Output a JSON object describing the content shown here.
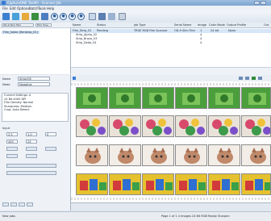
{
  "window": {
    "title": "CaptureONE ToolKit - Scanner Job"
  },
  "menu": [
    "File",
    "Edit",
    "Options",
    "Batch",
    "Tools",
    "Help"
  ],
  "toolbar_icons": [
    "scan-icon",
    "grid-icon",
    "folder-icon",
    "image-icon",
    "refresh-icon",
    "preview-circle-icon",
    "zoom-circle-icon",
    "rotate-circle-icon",
    "settings-circle-icon",
    "crop-icon",
    "frame-icon",
    "split-icon",
    "pages-icon"
  ],
  "sidebar": {
    "scanner_select": "OD-9 Slim Film",
    "job_button": "Film Type",
    "tree_root": "Film_Index (filmstrip_01)"
  },
  "grid": {
    "columns": [
      "Name",
      "Status",
      "Job Type",
      "Serial Name",
      "Image",
      "Color Mode",
      "Output Profile",
      "Out"
    ],
    "rows": [
      {
        "name": "Film_Strip_01",
        "status": "Pending",
        "job_type": "TRUE RGB Film Scanner",
        "serial": "OD-9 Slim Film",
        "image": "1",
        "color": "24 bit",
        "profile": "None",
        "selected": true
      },
      {
        "name": "Strip_Alpha_02",
        "status": "",
        "job_type": "",
        "serial": "",
        "image": "4",
        "color": "",
        "profile": "",
        "selected": false
      },
      {
        "name": "Strip_Bravo_03",
        "status": "",
        "job_type": "",
        "serial": "",
        "image": "4",
        "color": "",
        "profile": "",
        "selected": false
      },
      {
        "name": "Strip_Delta_04",
        "status": "",
        "job_type": "",
        "serial": "",
        "image": "4",
        "color": "",
        "profile": "",
        "selected": false
      }
    ]
  },
  "panel": {
    "name_label": "Name",
    "name_value": "Strip005",
    "mode_label": "Mode",
    "mode_value": "Negative",
    "info_lines": [
      "Current Settings: A",
      "24 Bit  4000 DPI",
      "Film Density: Normal",
      "Sharpness: Medium",
      "Crop: Auto Detect"
    ],
    "input_label": "Input",
    "fields": [
      "2.5",
      "1.0",
      "0",
      "400",
      "24"
    ]
  },
  "thumbs": {
    "rows": 4,
    "cols": 6,
    "row_styles": [
      "green-photo",
      "flower-photo",
      "cat-photo",
      "toy-photo"
    ]
  },
  "status": {
    "left": "New jobs",
    "right": "Page 1 of 1  4 Images  24 Bit RGB  Ready  Sharpen"
  },
  "colors": {
    "accent": "#3a7bd5",
    "selection": "#d6e6f8",
    "green_photo": "#4b9e3c",
    "flower_photo": "#d84a6b",
    "cat_photo": "#c0896a",
    "toy_photo": "#e6c12e"
  }
}
